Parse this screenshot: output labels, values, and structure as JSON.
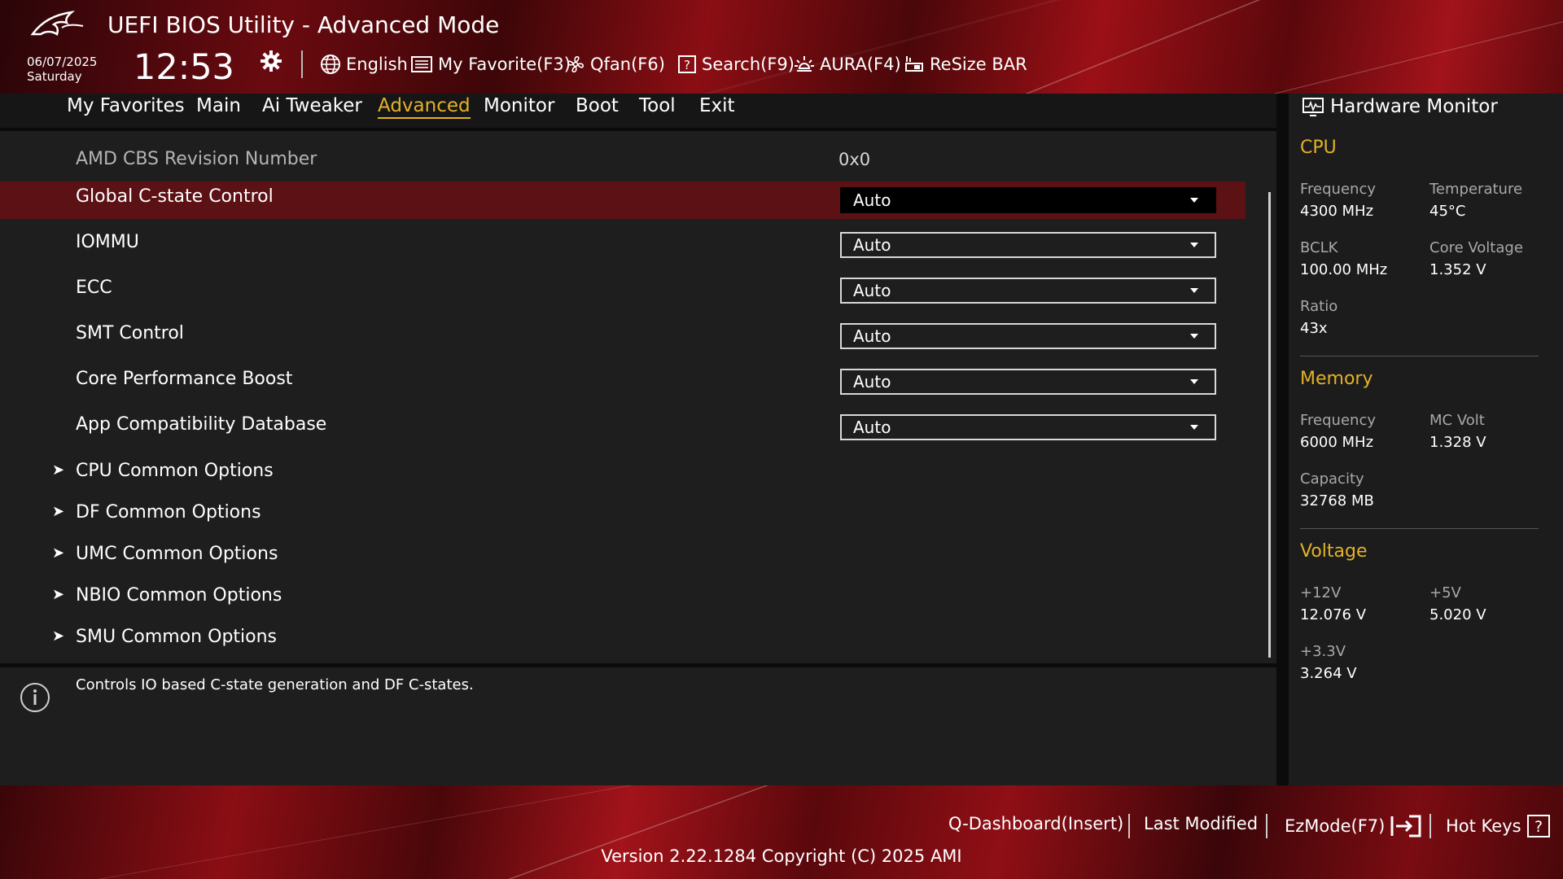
{
  "header": {
    "title": "UEFI BIOS Utility - Advanced Mode",
    "date": "06/07/2025",
    "day": "Saturday",
    "time": "12:53",
    "tools": {
      "language": "English",
      "favorite": "My Favorite(F3)",
      "qfan": "Qfan(F6)",
      "search": "Search(F9)",
      "aura": "AURA(F4)",
      "resize_bar": "ReSize BAR"
    }
  },
  "menu": {
    "tabs": [
      "My Favorites",
      "Main",
      "Ai Tweaker",
      "Advanced",
      "Monitor",
      "Boot",
      "Tool",
      "Exit"
    ],
    "active": "Advanced"
  },
  "settings": {
    "revision": {
      "label": "AMD CBS Revision Number",
      "value": "0x0"
    },
    "items": [
      {
        "label": "Global C-state Control",
        "value": "Auto"
      },
      {
        "label": "IOMMU",
        "value": "Auto"
      },
      {
        "label": "ECC",
        "value": "Auto"
      },
      {
        "label": "SMT Control",
        "value": "Auto"
      },
      {
        "label": "Core Performance Boost",
        "value": "Auto"
      },
      {
        "label": "App Compatibility Database",
        "value": "Auto"
      }
    ],
    "submenus": [
      "CPU Common Options",
      "DF Common Options",
      "UMC Common Options",
      "NBIO Common Options",
      "SMU Common Options"
    ]
  },
  "help": {
    "text": "Controls IO based C-state generation and DF C-states."
  },
  "hardware_monitor": {
    "title": "Hardware Monitor",
    "cpu": {
      "heading": "CPU",
      "frequency_label": "Frequency",
      "frequency": "4300 MHz",
      "temperature_label": "Temperature",
      "temperature": "45°C",
      "bclk_label": "BCLK",
      "bclk": "100.00 MHz",
      "core_voltage_label": "Core Voltage",
      "core_voltage": "1.352 V",
      "ratio_label": "Ratio",
      "ratio": "43x"
    },
    "memory": {
      "heading": "Memory",
      "frequency_label": "Frequency",
      "frequency": "6000 MHz",
      "mc_volt_label": "MC Volt",
      "mc_volt": "1.328 V",
      "capacity_label": "Capacity",
      "capacity": "32768 MB"
    },
    "voltage": {
      "heading": "Voltage",
      "v12_label": "+12V",
      "v12": "12.076 V",
      "v5_label": "+5V",
      "v5": "5.020 V",
      "v33_label": "+3.3V",
      "v33": "3.264 V"
    }
  },
  "footer": {
    "q_dashboard": "Q-Dashboard(Insert)",
    "last_modified": "Last Modified",
    "ezmode": "EzMode(F7)",
    "hot_keys": "Hot Keys",
    "version": "Version 2.22.1284 Copyright (C) 2025 AMI"
  },
  "colors": {
    "accent": "#e3b227",
    "selected_row": "#5c1114",
    "brand_red": "#a2131a"
  }
}
